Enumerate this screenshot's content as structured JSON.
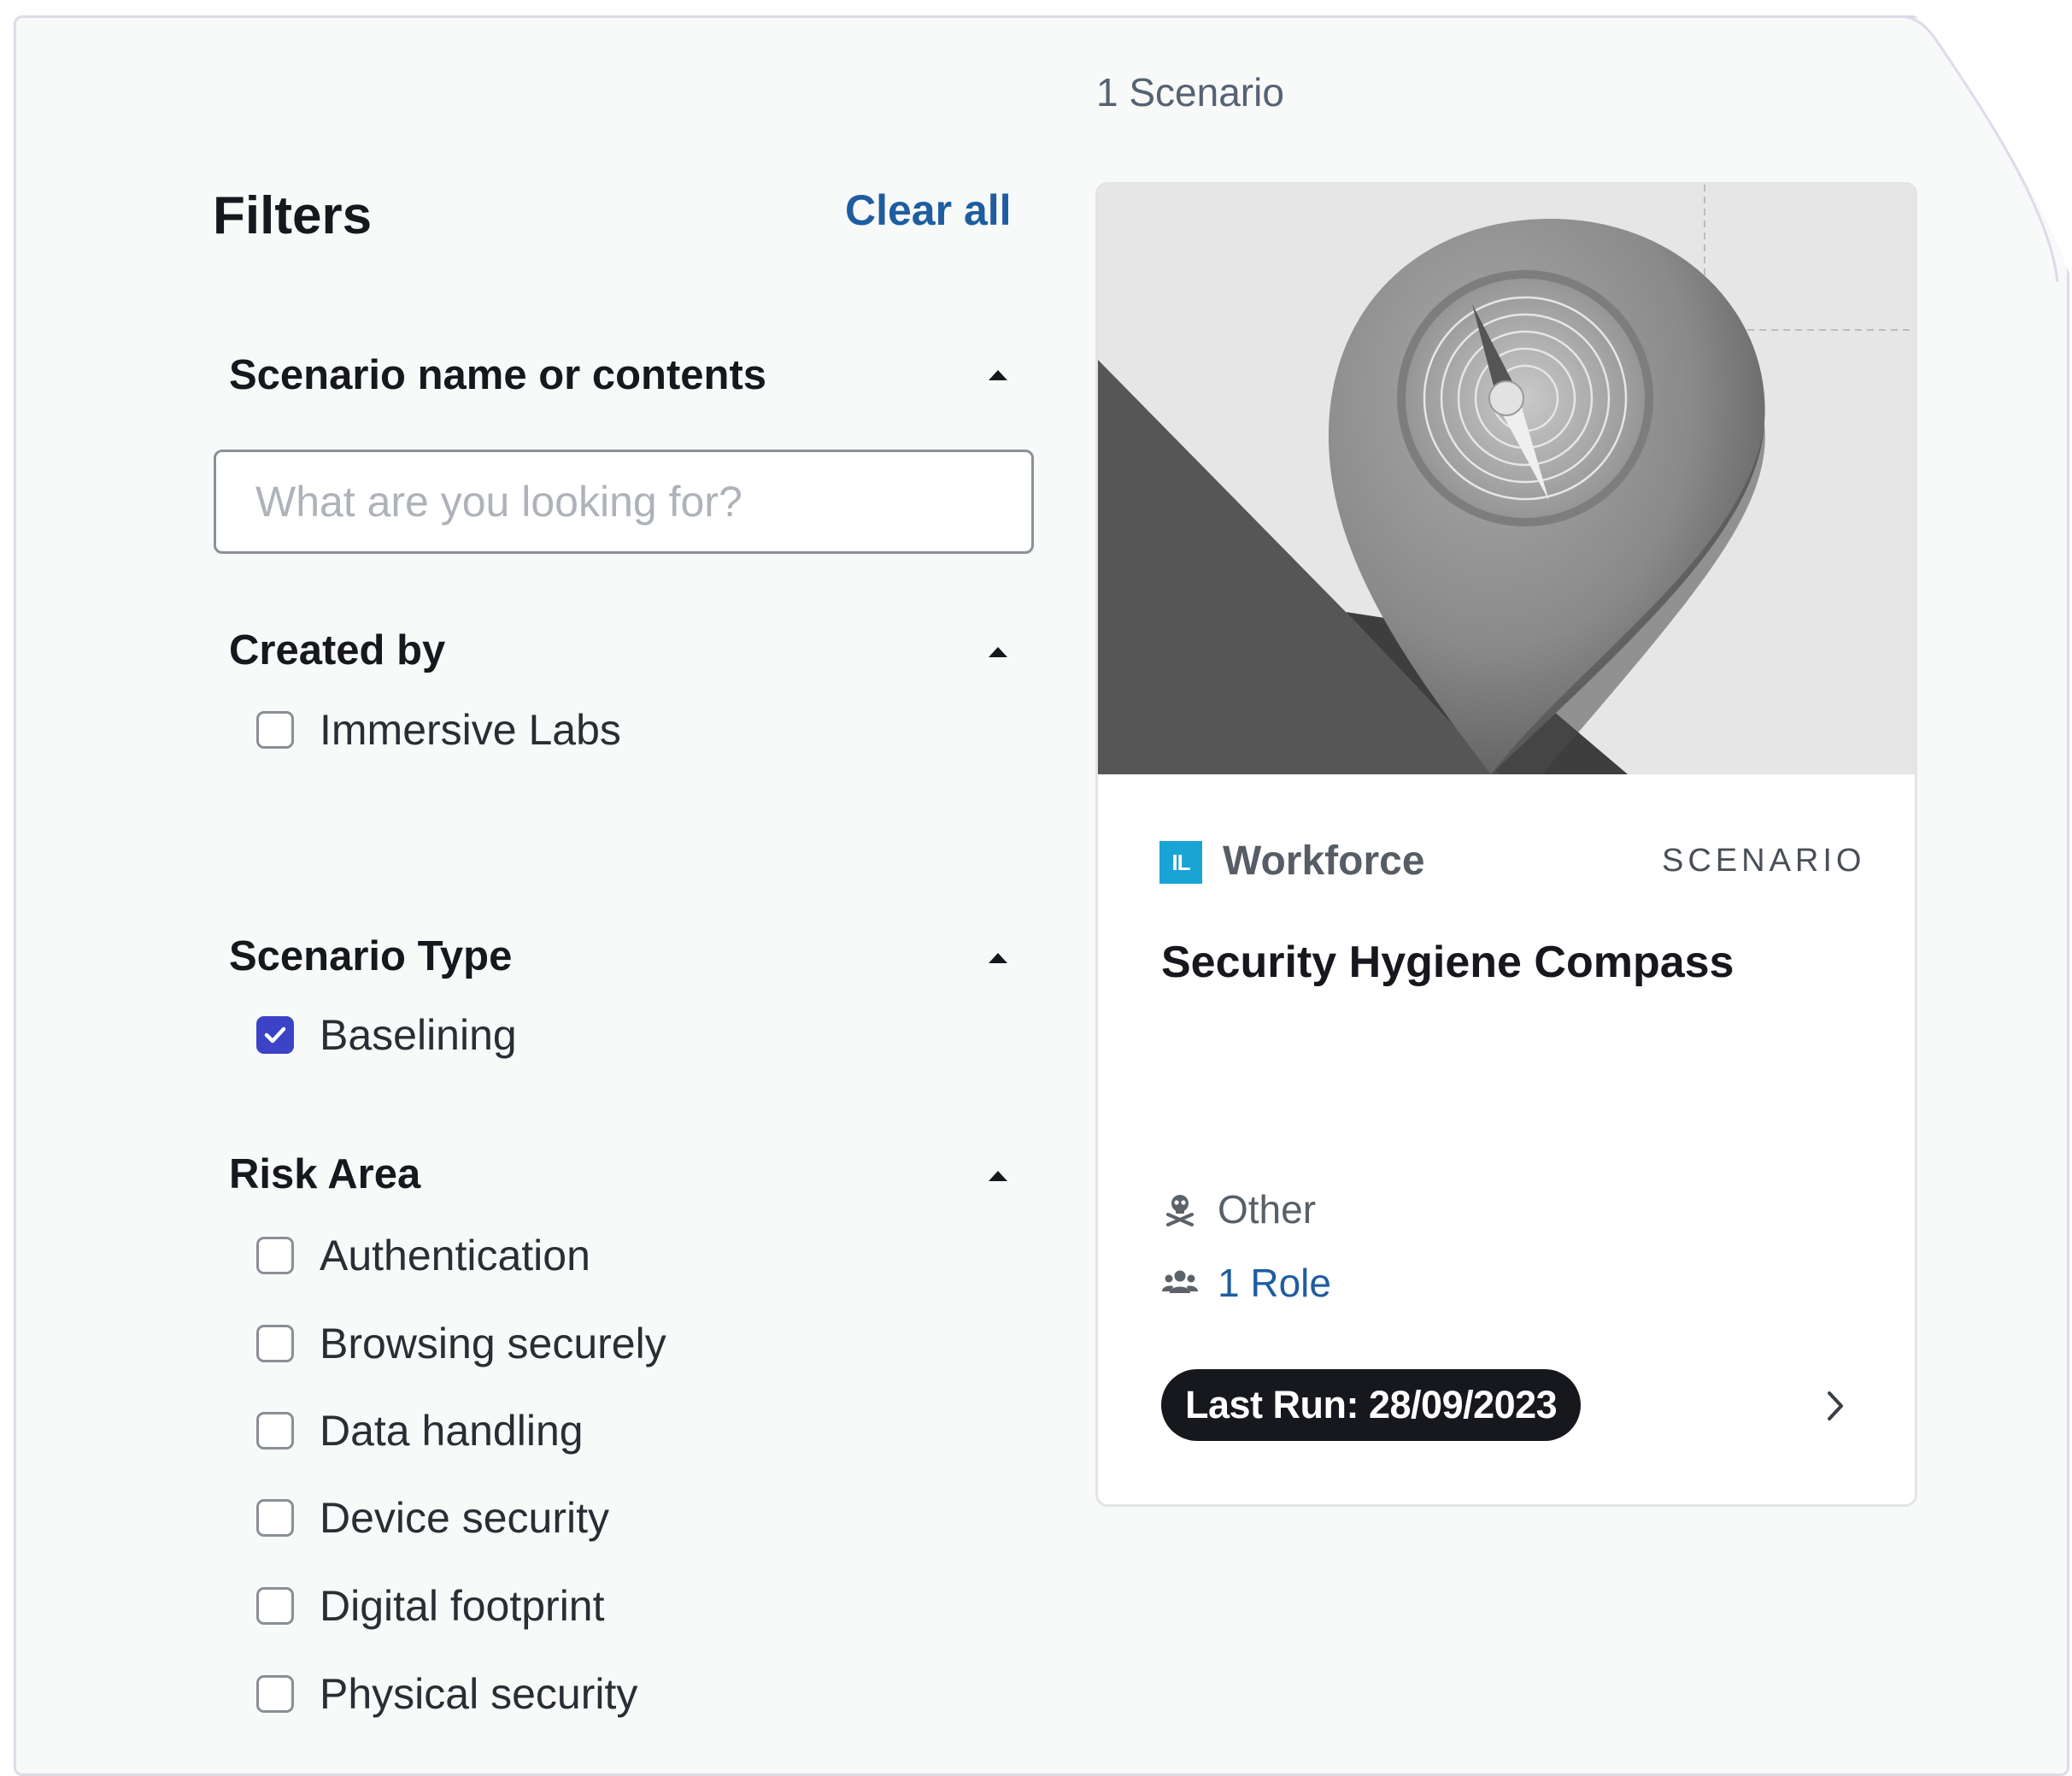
{
  "results": {
    "count_label": "1 Scenario"
  },
  "filters": {
    "title": "Filters",
    "clear_all_label": "Clear all",
    "search_section": {
      "title": "Scenario name or contents",
      "placeholder": "What are you looking for?",
      "value": ""
    },
    "created_by": {
      "title": "Created by",
      "options": [
        {
          "label": "Immersive Labs",
          "checked": false
        }
      ]
    },
    "scenario_type": {
      "title": "Scenario Type",
      "options": [
        {
          "label": "Baselining",
          "checked": true
        }
      ]
    },
    "risk_area": {
      "title": "Risk Area",
      "options": [
        {
          "label": "Authentication",
          "checked": false
        },
        {
          "label": "Browsing securely",
          "checked": false
        },
        {
          "label": "Data handling",
          "checked": false
        },
        {
          "label": "Device security",
          "checked": false
        },
        {
          "label": "Digital footprint",
          "checked": false
        },
        {
          "label": "Physical security",
          "checked": false
        }
      ]
    }
  },
  "card": {
    "image_icon": "compass-map-pin-image",
    "brand_logo_text": "IL",
    "brand_logo_color": "#19a4d6",
    "brand_name": "Workforce",
    "type_label": "SCENARIO",
    "title": "Security Hygiene Compass",
    "category_icon": "skull-crossbones-icon",
    "category": "Other",
    "roles_icon": "users-icon",
    "roles": "1 Role",
    "last_run": "Last Run: 28/09/2023",
    "open_icon": "chevron-right-icon"
  },
  "colors": {
    "accent_blue": "#1e5da0",
    "checkbox_checked": "#3b44c6",
    "pill_background": "#16181d"
  }
}
